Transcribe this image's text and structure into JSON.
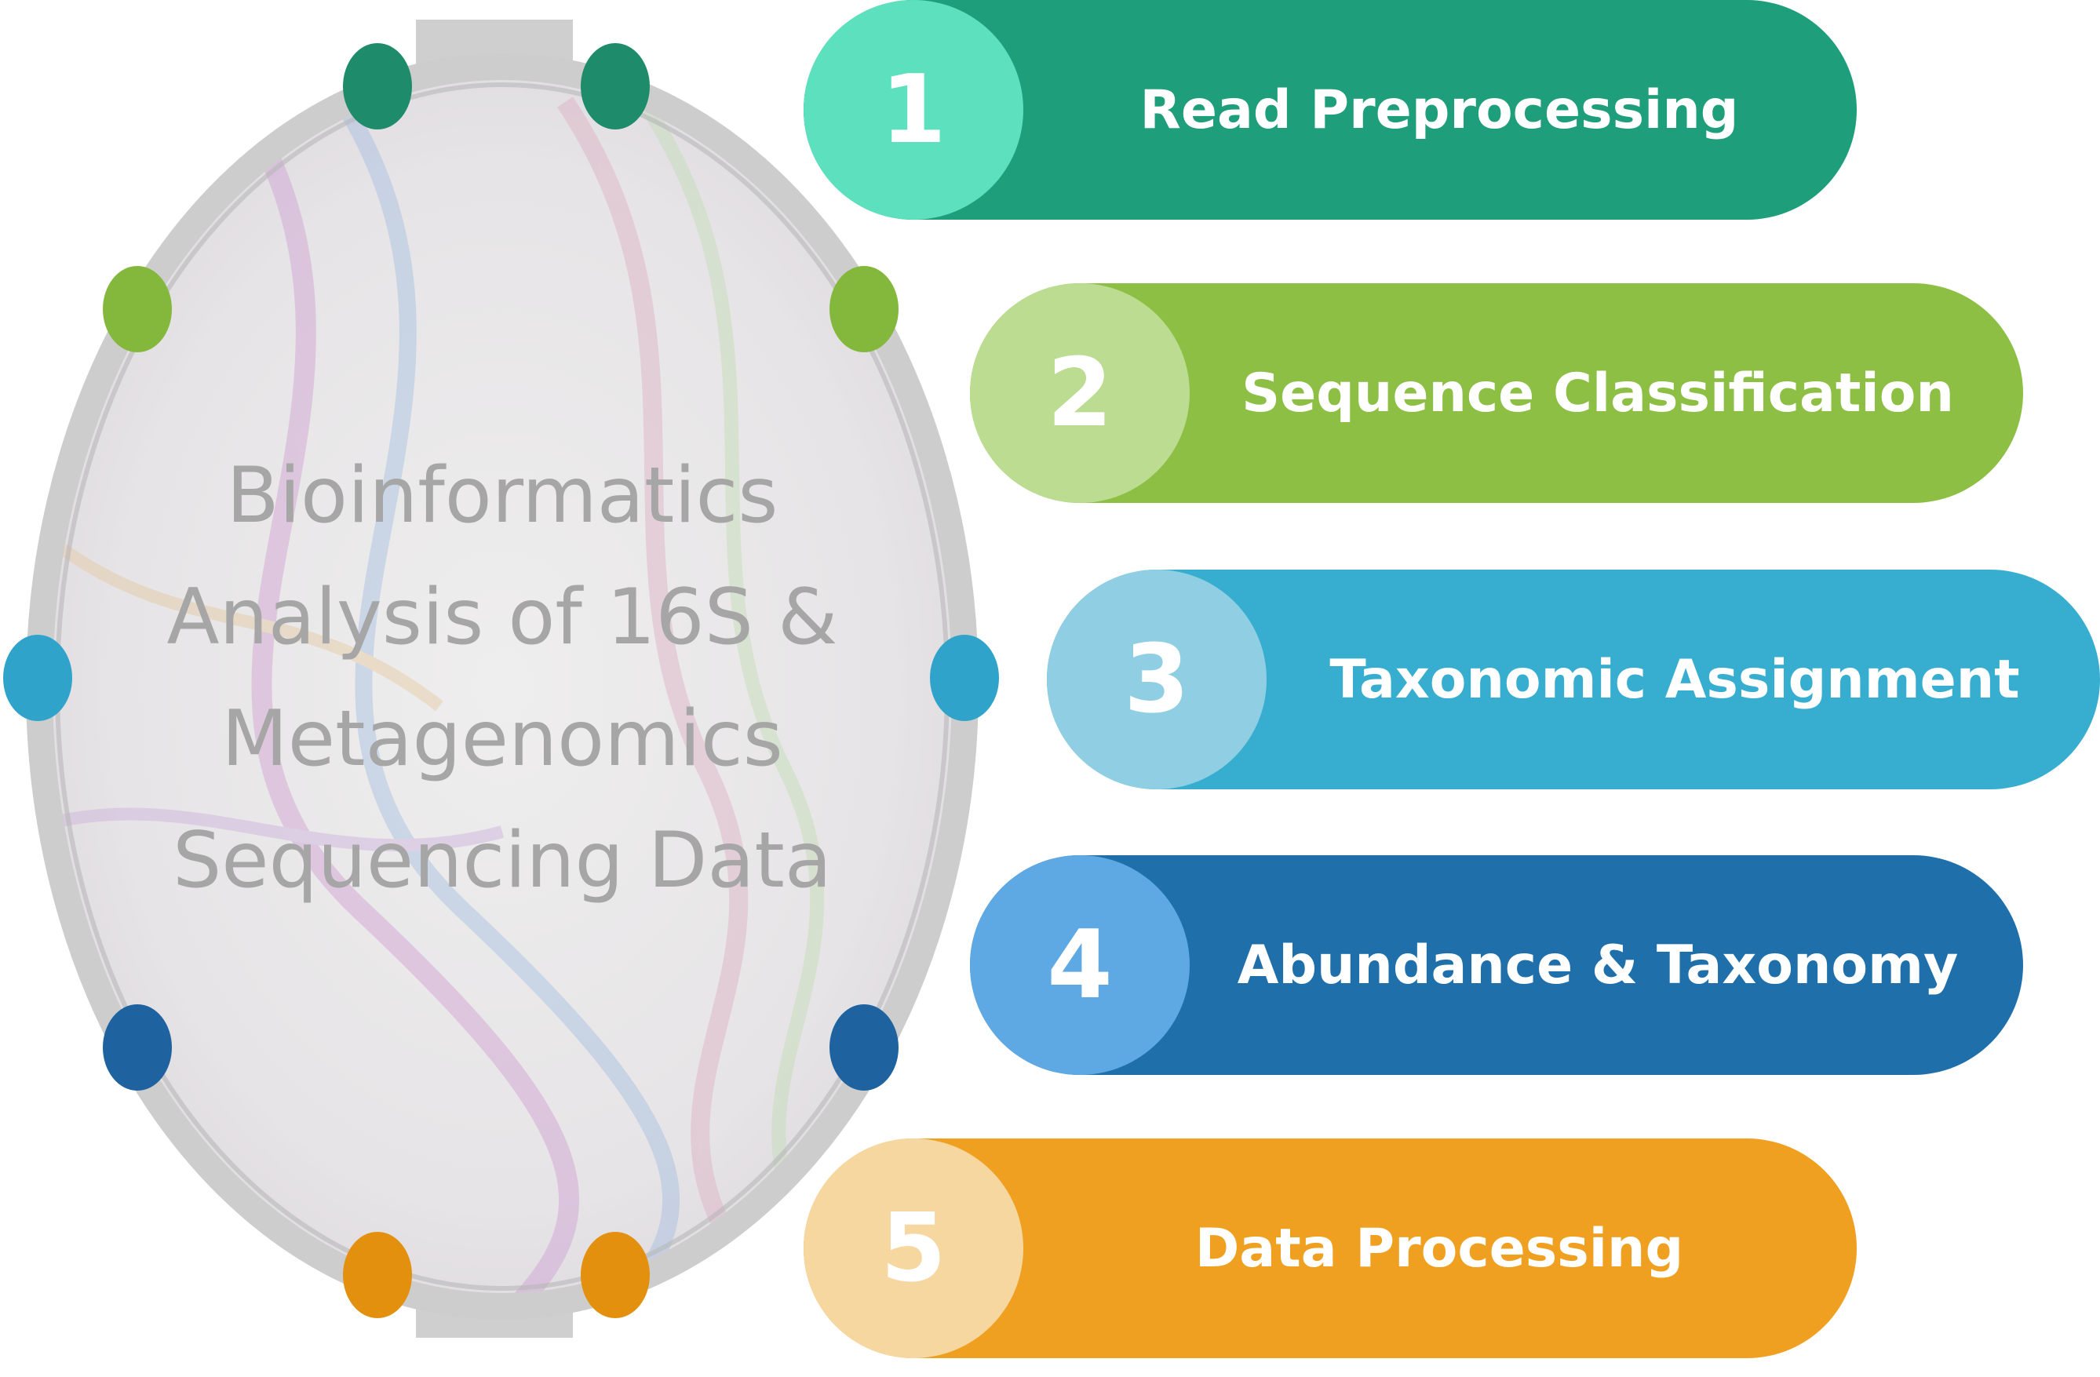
{
  "center": {
    "title_lines": [
      "Bioinformatics",
      "Analysis of 16S &",
      "Metagenomics",
      "Sequencing Data"
    ]
  },
  "steps": [
    {
      "number": "1",
      "label": "Read Preprocessing",
      "bar_color": "#1e9e7a",
      "badge_color": "#5ce0bd"
    },
    {
      "number": "2",
      "label": "Sequence Classification",
      "bar_color": "#8cbf44",
      "badge_color": "#bcdc91"
    },
    {
      "number": "3",
      "label": "Taxonomic Assignment",
      "bar_color": "#37aed0",
      "badge_color": "#8fcee3"
    },
    {
      "number": "4",
      "label": "Abundance & Taxonomy",
      "bar_color": "#1f6fab",
      "badge_color": "#5ea9e3"
    },
    {
      "number": "5",
      "label": "Data Processing",
      "bar_color": "#f0a020",
      "badge_color": "#f7d7a0"
    }
  ],
  "dot_colors": {
    "top": "#1e8c6a",
    "upper": "#84b83c",
    "middle": "#2fa3c9",
    "lower": "#1e62a0",
    "bottom": "#e3900f"
  }
}
